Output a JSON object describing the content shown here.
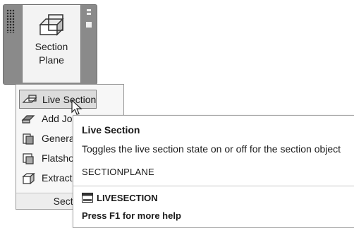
{
  "ribbon": {
    "button_label_line1": "Section",
    "button_label_line2": "Plane",
    "button_icon": "section-plane-icon",
    "panel_pin_icon": "pin-icon",
    "panel_expand_icon": "panel-launcher-icon"
  },
  "menu": {
    "items": [
      {
        "label": "Live Section",
        "icon": "live-section-icon",
        "hover": true
      },
      {
        "label": "Add Jog",
        "icon": "add-jog-icon"
      },
      {
        "label": "Generate Section",
        "icon": "generate-section-icon"
      },
      {
        "label": "Flatshot",
        "icon": "flatshot-icon"
      },
      {
        "label": "Extract",
        "icon": "extract-icon"
      }
    ],
    "footer_label": "Section"
  },
  "tooltip": {
    "title": "Live Section",
    "description": "Toggles the live section state on or off for the section object",
    "command": "SECTIONPLANE",
    "command_name": "LIVESECTION",
    "command_icon": "command-line-icon",
    "help": "Press F1 for more help"
  },
  "colors": {
    "ribbon_bg": "#8a8a8a",
    "menu_bg": "#f7f7f7",
    "hover_bg": "#dcdcdc",
    "tooltip_bg": "#ffffff"
  }
}
